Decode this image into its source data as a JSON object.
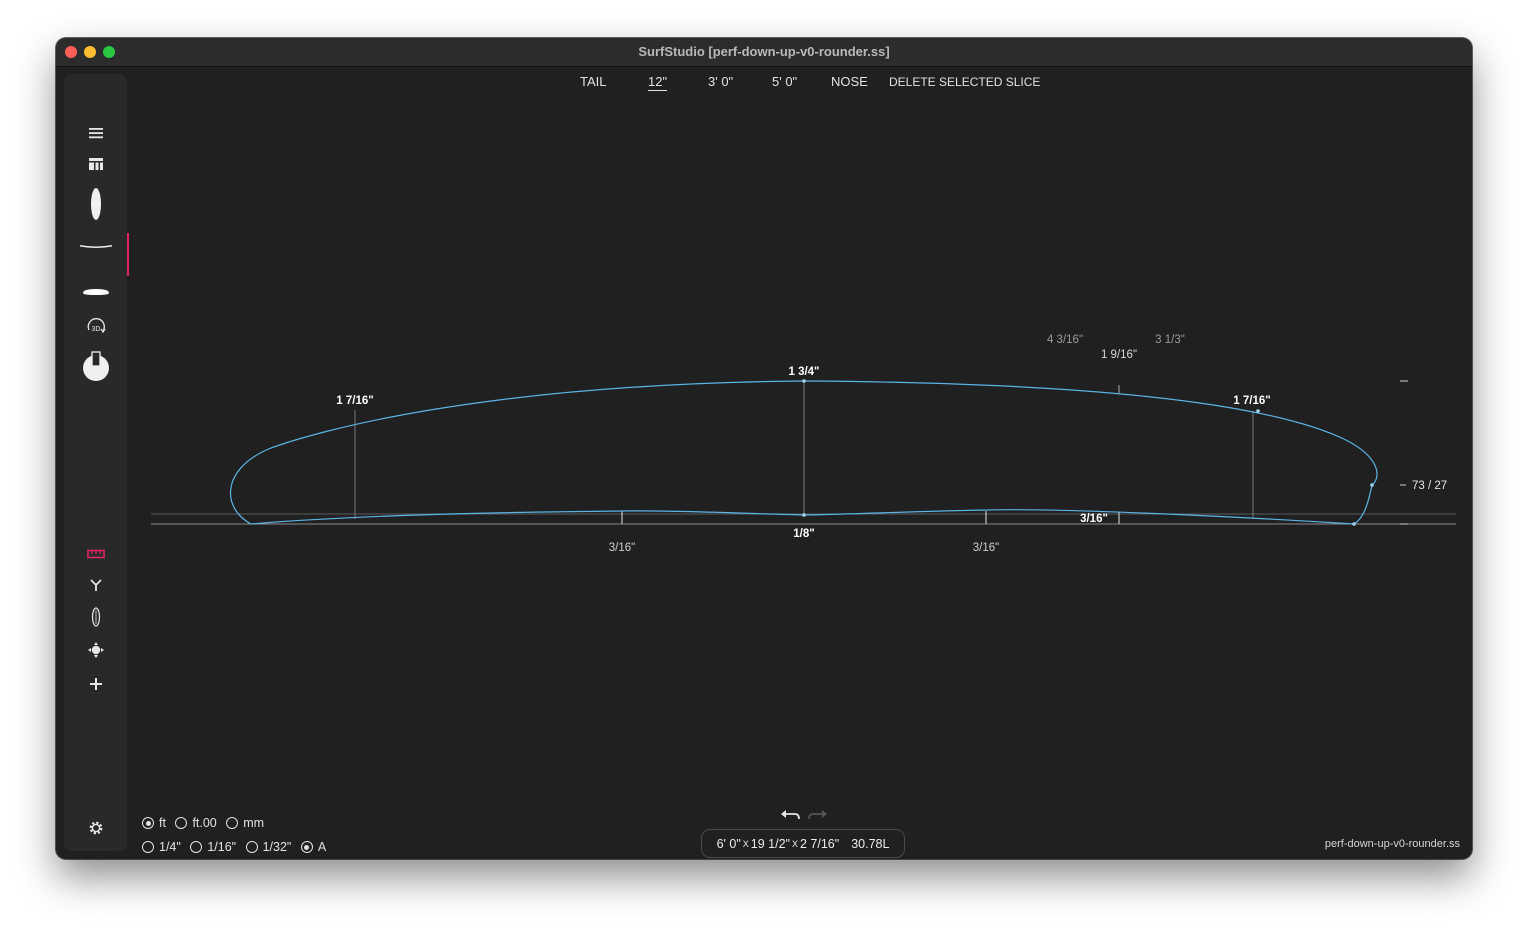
{
  "window": {
    "title": "SurfStudio [perf-down-up-v0-rounder.ss]"
  },
  "sidebar": {
    "items": [
      {
        "name": "menu-icon",
        "glyph": "≡"
      },
      {
        "name": "dashboard-icon",
        "glyph": "▦"
      },
      {
        "name": "outline-view-icon",
        "glyph": ""
      },
      {
        "name": "rocker-view-icon",
        "glyph": ""
      },
      {
        "name": "slice-view-icon",
        "glyph": ""
      },
      {
        "name": "3d-view-icon",
        "glyph": "3D"
      },
      {
        "name": "fins-icon",
        "glyph": ""
      }
    ],
    "tools": [
      {
        "name": "ruler-icon",
        "glyph": "▭"
      },
      {
        "name": "branch-icon",
        "glyph": "Y"
      },
      {
        "name": "board-outline-icon",
        "glyph": "◊"
      },
      {
        "name": "crosshair-icon",
        "glyph": "✥"
      },
      {
        "name": "add-icon",
        "glyph": "+"
      }
    ],
    "settings": {
      "name": "settings-icon",
      "glyph": "⚙"
    }
  },
  "nav": {
    "tail": "TAIL",
    "slice_12": "12\"",
    "slice_3_0": "3' 0\"",
    "slice_5_0": "5' 0\"",
    "nose": "NOSE",
    "delete": "DELETE SELECTED SLICE"
  },
  "measurements": {
    "top_left": "1 7/16\"",
    "top_center": "1 3/4\"",
    "top_right": "1 7/16\"",
    "top_far_left": "4 3/16\"",
    "top_far_mid": "1 9/16\"",
    "top_far_right": "3 1/3\"",
    "bottom_center": "1/8\"",
    "bottom_left": "3/16\"",
    "bottom_right": "3/16\"",
    "bottom_right_bold": "3/16\"",
    "rail_ratio": "73 / 27"
  },
  "units": {
    "length_options": [
      "ft",
      "ft.00",
      "mm"
    ],
    "length_selected": "ft",
    "fraction_options": [
      "1/4\"",
      "1/16\"",
      "1/32\"",
      "A"
    ],
    "fraction_selected": "A"
  },
  "dimensions": {
    "length": "6' 0\"",
    "x1": "X",
    "width": "19 1/2\"",
    "x2": "X",
    "thickness": "2 7/16\"",
    "volume": "30.78L"
  },
  "footer": {
    "filename": "perf-down-up-v0-rounder.ss"
  },
  "colors": {
    "accent": "#e0245e",
    "curve": "#5ab4e5",
    "background": "#202020"
  }
}
